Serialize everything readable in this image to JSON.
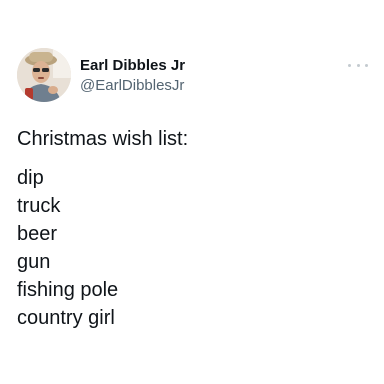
{
  "author": {
    "display_name": "Earl Dibbles Jr",
    "handle": "@EarlDibblesJr"
  },
  "more_icon": "ellipsis-icon",
  "tweet": {
    "heading": "Christmas wish list:",
    "items": [
      "dip",
      "truck",
      "beer",
      "gun",
      "fishing pole",
      "country girl"
    ]
  },
  "colors": {
    "text": "#0f1419",
    "secondary": "#536471",
    "background": "#ffffff"
  }
}
